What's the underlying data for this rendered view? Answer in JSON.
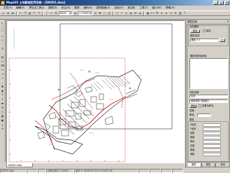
{
  "title_bar": {
    "title": "MapGIS 土地勘测定界系统 - [DK001.dwo]"
  },
  "menu": {
    "items": [
      "文件(F)",
      "编辑(E)",
      "界址点工具(J)",
      "图斑(D)",
      "标注(B)",
      "图廓",
      "面积(A)",
      "整饰图面(Z)",
      "坐标(G)",
      "多边形",
      "工具(T)",
      "窗口(W)",
      "帮助(H)"
    ]
  },
  "toolbar": {
    "layer_value": "DK01",
    "scale_value": "1:10000"
  },
  "canvas": {
    "doc_tab": "DK001.dwo"
  },
  "status_bar": {
    "cells": [
      "DK001.dwo",
      "",
      "",
      "当前比例尺 1:10000",
      "坐标 X: 3849125.35  Y: 512875.40",
      "",
      "",
      "",
      ""
    ]
  },
  "right_panel": {
    "title": "图层控制",
    "group1_label": "当前图层",
    "show_btn": "显示",
    "lock_label": "锁定",
    "layer_label": "图层名称",
    "layer_value": "图层 1-1",
    "list1_label": "图层线型及颜色",
    "section_label": "线型设置",
    "line_combo": "实线",
    "select_combo": "选择线型 (按图层)",
    "add_btn": "添加",
    "chk_label": "设置为默认",
    "width_label": "线宽",
    "color_label": "颜色",
    "attr_label": "属性",
    "attrs": [
      {
        "k": "X坐标"
      },
      {
        "k": "Y坐标"
      },
      {
        "k": "线型"
      },
      {
        "k": "宽度"
      },
      {
        "k": "颜色"
      },
      {
        "k": "高度"
      },
      {
        "k": "角度"
      },
      {
        "k": "间距"
      }
    ],
    "tabs": [
      "图层",
      "属性",
      "查询"
    ]
  }
}
